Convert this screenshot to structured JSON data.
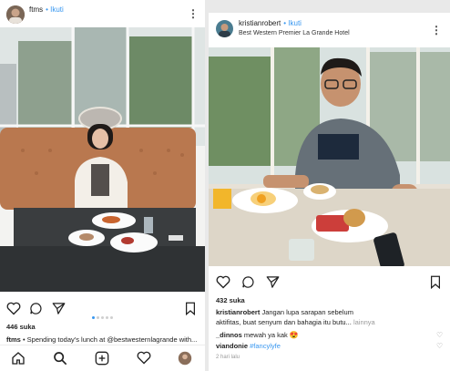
{
  "left_post": {
    "username": "ftms",
    "follow": "• Ikuti",
    "likes": "446 suka",
    "caption_user": "ftms",
    "caption_text": "• Spending today's lunch at @bestwesternlagrande with...",
    "carousel": {
      "count": 5,
      "active": 1
    }
  },
  "right_post": {
    "username": "kristianrobert",
    "follow": "• Ikuti",
    "location": "Best Western Premier La Grande Hotel",
    "likes": "432 suka",
    "caption_user": "kristianrobert",
    "caption_text": "Jangan lupa sarapan sebelum",
    "caption_line2": "aktifitas, buat senyum dan bahagia itu butu...",
    "more_label": "lainnya",
    "comments": [
      {
        "user": "_dinnos",
        "text": "mewah ya kak"
      },
      {
        "user": "viandonie",
        "text": "#fancylyfe"
      }
    ],
    "time_ago": "2 hari lalu"
  },
  "icons": {
    "like": "heart-icon",
    "comment": "comment-icon",
    "share": "send-icon",
    "save": "bookmark-icon",
    "more": "more-vertical-icon"
  },
  "colors": {
    "accent": "#3897f0",
    "text": "#222222"
  }
}
